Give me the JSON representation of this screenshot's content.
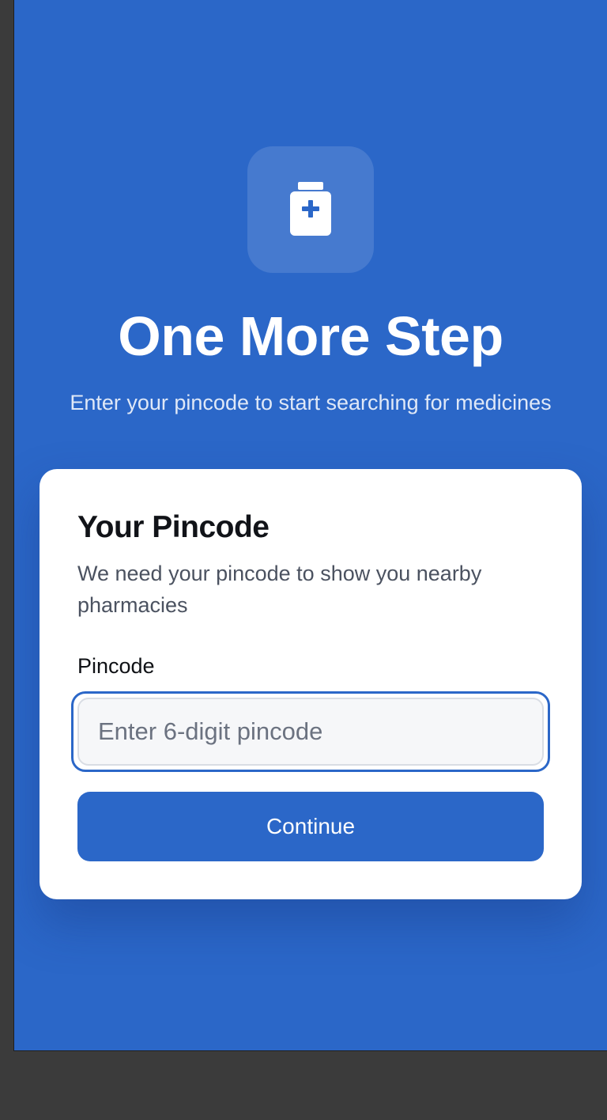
{
  "header": {
    "icon": "medicine-bottle-plus-icon",
    "title": "One More Step",
    "subtitle": "Enter your pincode to start searching for medicines"
  },
  "card": {
    "title": "Your Pincode",
    "description": "We need your pincode to show you nearby pharmacies",
    "field_label": "Pincode",
    "input_value": "",
    "input_placeholder": "Enter 6-digit pincode",
    "button_label": "Continue"
  },
  "colors": {
    "background": "#2b67c8",
    "card": "#ffffff",
    "accent": "#2b67c8",
    "icon_plus": "#2b67c8"
  }
}
